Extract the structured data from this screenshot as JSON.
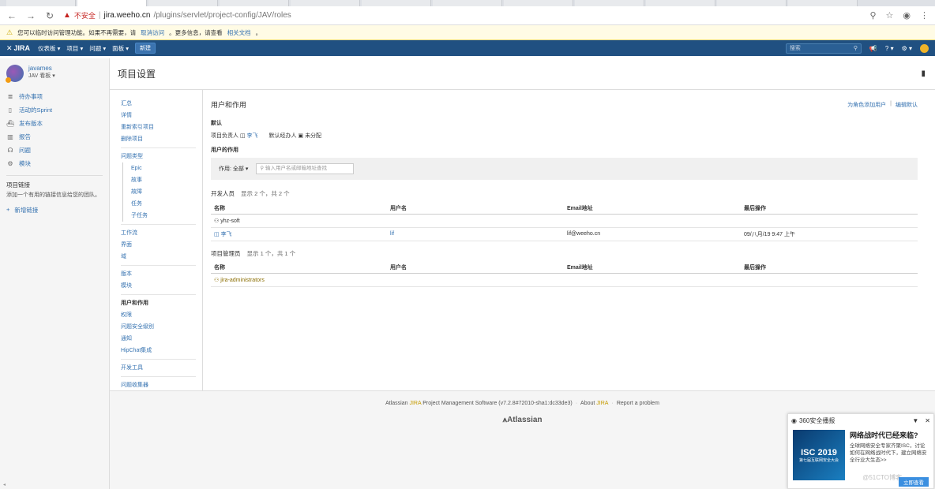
{
  "browser": {
    "tabs": [
      "",
      "",
      "",
      "",
      "",
      "",
      "",
      "",
      "",
      "",
      "",
      ""
    ],
    "url_warning": "不安全",
    "url_host": "jira.weeho.cn",
    "url_path": "/plugins/servlet/project-config/JAV/roles"
  },
  "infobar": {
    "text": "您可以临时访问管理功能。如果不再需要，请",
    "link1": "取消访问",
    "mid": "。更多信息，请查看",
    "link2": "相关文档",
    "end": "。"
  },
  "header": {
    "logo": "JIRA",
    "nav": [
      "仪表板",
      "项目",
      "问题",
      "面板"
    ],
    "create": "新建",
    "search_placeholder": "搜索"
  },
  "sidebar": {
    "project_name": "javames",
    "project_sub": "JAV 看板",
    "items": [
      {
        "icon": "backlog-icon",
        "glyph": "≣",
        "label": "待办事项"
      },
      {
        "icon": "sprint-icon",
        "glyph": "▯",
        "label": "活动的Sprint"
      },
      {
        "icon": "release-icon",
        "glyph": "⛴",
        "label": "发布版本"
      },
      {
        "icon": "report-icon",
        "glyph": "▥",
        "label": "报告"
      },
      {
        "icon": "issues-icon",
        "glyph": "☊",
        "label": "问题"
      },
      {
        "icon": "components-icon",
        "glyph": "⚙",
        "label": "模块"
      }
    ],
    "links_title": "项目链接",
    "links_desc": "添加一个有用的链接信息给您的团队。",
    "add_link": "新增链接"
  },
  "page": {
    "title": "项目设置"
  },
  "admin_nav": {
    "group1": [
      "汇总",
      "详情",
      "重新索引项目",
      "删除项目"
    ],
    "issue_types": "问题类型",
    "issue_sub": [
      "Epic",
      "故事",
      "故障",
      "任务",
      "子任务"
    ],
    "group2": [
      "工作流",
      "界面",
      "域"
    ],
    "group3": [
      "版本",
      "模块"
    ],
    "group4_current": "用户和作用",
    "group4": [
      "权限",
      "问题安全级别",
      "通知",
      "HipChat集成"
    ],
    "group5": [
      "开发工具"
    ],
    "group6": [
      "问题收集器"
    ]
  },
  "panel": {
    "title": "用户和作用",
    "action_add": "为角色添加用户",
    "action_sep": "|",
    "action_edit": "编辑默认",
    "default_label": "默认",
    "lead_label": "项目负责人",
    "lead_value": "李飞",
    "assignee_label": "默认经办人",
    "assignee_value": "未分配",
    "roles_label": "用户的作用",
    "role_select": "作用: 全部",
    "user_search_placeholder": "输入用户名或邮箱地址查找",
    "columns": [
      "名称",
      "用户名",
      "Email地址",
      "最后操作"
    ],
    "groups": [
      {
        "name": "开发人员",
        "count": "显示 2 个，共 2 个",
        "rows": [
          {
            "name": "yhz-soft",
            "username": "",
            "email": "",
            "last": "",
            "type": "group"
          },
          {
            "name": "李飞",
            "username": "lif",
            "email": "lif@weeho.cn",
            "last": "09/八月/19 9:47 上午",
            "type": "user"
          }
        ]
      },
      {
        "name": "项目管理员",
        "count": "显示 1 个，共 1 个",
        "rows": [
          {
            "name": "jira-administrators",
            "username": "",
            "email": "",
            "last": "",
            "type": "group"
          }
        ]
      }
    ]
  },
  "footer": {
    "prefix": "Atlassian",
    "jira": "JIRA",
    "text": "Project Management Software (v7.2.8#72010-sha1:dc33de3)",
    "about_prefix": "About",
    "about_jira": "JIRA",
    "report": "Report a problem",
    "logo": "Atlassian"
  },
  "popup": {
    "title": "360安全播报",
    "badge_big": "ISC 2019",
    "badge_small": "第七届互联网安全大会",
    "headline": "网络战时代已经来临?",
    "desc": "全球网络安全专家齐聚ISC，讨论如何在网络战时代下，建立网络安全行业大生态>>",
    "button": "立即查看",
    "watermark": "@51CTO博客"
  }
}
